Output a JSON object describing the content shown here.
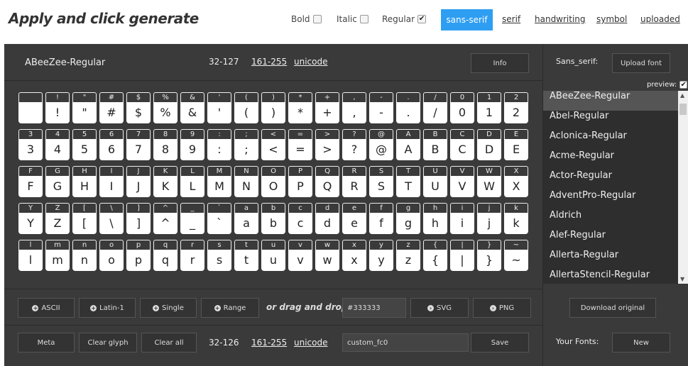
{
  "header": {
    "title": "Apply and click generate",
    "options": [
      {
        "label": "Bold",
        "checked": false
      },
      {
        "label": "Italic",
        "checked": false
      },
      {
        "label": "Regular",
        "checked": true
      }
    ],
    "tabs": [
      "sans-serif",
      "serif",
      "handwriting",
      "symbol",
      "uploaded"
    ],
    "active_tab": "sans-serif"
  },
  "panel": {
    "font_name": "ABeeZee-Regular",
    "range_plain": "32-127",
    "range_latin": "161-255",
    "range_unicode": "unicode",
    "info_label": "Info"
  },
  "glyph_rows": [
    {
      "labels": [
        "",
        "!",
        "\"",
        "#",
        "$",
        "%",
        "&",
        "'",
        "(",
        ")",
        "*",
        "+",
        ",",
        "-",
        ".",
        "/",
        "0",
        "1",
        "2"
      ],
      "glyphs": [
        "",
        "!",
        "\"",
        "#",
        "$",
        "%",
        "&",
        "'",
        "(",
        ")",
        "*",
        "+",
        ",",
        "-",
        ".",
        "/",
        "0",
        "1",
        "2"
      ]
    },
    {
      "labels": [
        "3",
        "4",
        "5",
        "6",
        "7",
        "8",
        "9",
        ":",
        ";",
        "<",
        "=",
        ">",
        "?",
        "@",
        "A",
        "B",
        "C",
        "D",
        "E"
      ],
      "glyphs": [
        "3",
        "4",
        "5",
        "6",
        "7",
        "8",
        "9",
        ":",
        ";",
        "<",
        "=",
        ">",
        "?",
        "@",
        "A",
        "B",
        "C",
        "D",
        "E"
      ]
    },
    {
      "labels": [
        "F",
        "G",
        "H",
        "I",
        "J",
        "K",
        "L",
        "M",
        "N",
        "O",
        "P",
        "Q",
        "R",
        "S",
        "T",
        "U",
        "V",
        "W",
        "X"
      ],
      "glyphs": [
        "F",
        "G",
        "H",
        "I",
        "J",
        "K",
        "L",
        "M",
        "N",
        "O",
        "P",
        "Q",
        "R",
        "S",
        "T",
        "U",
        "V",
        "W",
        "X"
      ]
    },
    {
      "labels": [
        "Y",
        "Z",
        "[",
        "\\",
        "]",
        "^",
        "_",
        "`",
        "a",
        "b",
        "c",
        "d",
        "e",
        "f",
        "g",
        "h",
        "i",
        "j",
        "k"
      ],
      "glyphs": [
        "Y",
        "Z",
        "[",
        "\\",
        "]",
        "^",
        "_",
        "`",
        "a",
        "b",
        "c",
        "d",
        "e",
        "f",
        "g",
        "h",
        "i",
        "j",
        "k"
      ]
    },
    {
      "labels": [
        "l",
        "m",
        "n",
        "o",
        "p",
        "q",
        "r",
        "s",
        "t",
        "u",
        "v",
        "w",
        "x",
        "y",
        "z",
        "{",
        "|",
        "}",
        "~"
      ],
      "glyphs": [
        "l",
        "m",
        "n",
        "o",
        "p",
        "q",
        "r",
        "s",
        "t",
        "u",
        "v",
        "w",
        "x",
        "y",
        "z",
        "{",
        "|",
        "}",
        "~"
      ]
    }
  ],
  "add_buttons": {
    "ascii": "ASCII",
    "latin": "Latin-1",
    "single": "Single",
    "range": "Range",
    "drag_text": "or drag and drop",
    "color_value": "#333333",
    "svg": "SVG",
    "png": "PNG"
  },
  "bottom": {
    "meta": "Meta",
    "clear_glyph": "Clear glyph",
    "clear_all": "Clear all",
    "range_plain": "32-126",
    "range_latin": "161-255",
    "range_unicode": "unicode",
    "font_name_value": "custom_fc0",
    "save": "Save"
  },
  "right": {
    "category_label": "Sans_serif:",
    "upload_label": "Upload font",
    "preview_label": "preview:",
    "preview_checked": true,
    "fonts": [
      "ABeeZee-Regular",
      "Abel-Regular",
      "Aclonica-Regular",
      "Acme-Regular",
      "Actor-Regular",
      "AdventPro-Regular",
      "Aldrich",
      "Alef-Regular",
      "Allerta-Regular",
      "AllertaStencil-Regular"
    ],
    "selected_font": "ABeeZee-Regular",
    "download_label": "Download original",
    "your_fonts_label": "Your Fonts:",
    "new_label": "New"
  },
  "colors": {
    "accent": "#2e9ef3",
    "panel_bg": "#3a3a3a",
    "list_bg": "#2e2e2e"
  }
}
